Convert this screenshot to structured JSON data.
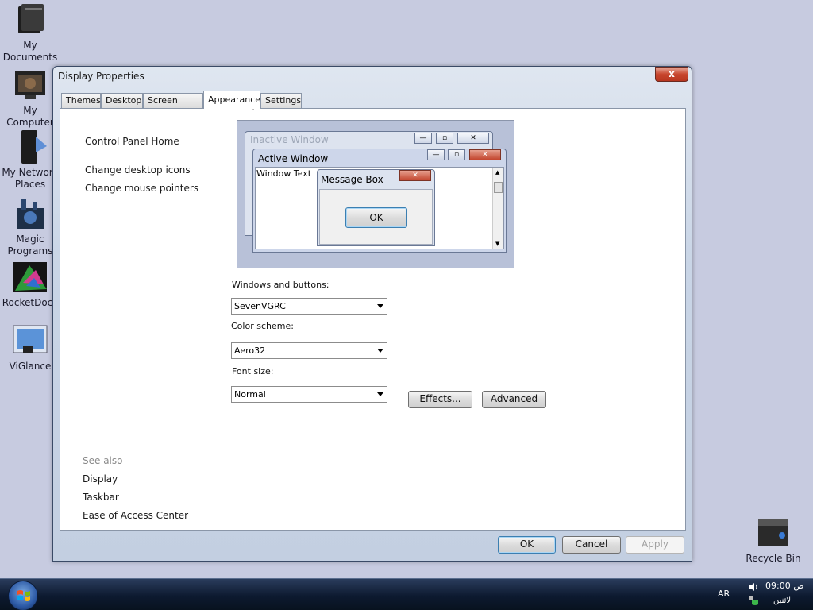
{
  "desktop": {
    "icons": [
      {
        "label": "My Documents",
        "icon": "documents-icon"
      },
      {
        "label": "My Computer",
        "icon": "computer-icon"
      },
      {
        "label": "My Network Places",
        "icon": "network-icon"
      },
      {
        "label": "Magic Programs",
        "icon": "magic-programs-icon"
      },
      {
        "label": "RocketDock",
        "icon": "rocketdock-icon"
      },
      {
        "label": "ViGlance",
        "icon": "viglance-icon"
      },
      {
        "label": "Recycle Bin",
        "icon": "recycle-bin-icon"
      }
    ]
  },
  "window": {
    "title": "Display Properties",
    "close": "x",
    "tabs": [
      "Themes",
      "Desktop",
      "Screen Saver",
      "Appearance",
      "Settings"
    ],
    "active_tab": "Appearance"
  },
  "sidebar": {
    "home": "Control Panel Home",
    "tasks": [
      "Change desktop icons",
      "Change mouse pointers"
    ],
    "see_also_label": "See also",
    "see_also": [
      "Display",
      "Taskbar",
      "Ease of Access Center"
    ]
  },
  "preview": {
    "inactive_title": "Inactive Window",
    "active_title": "Active Window",
    "window_text": "Window Text",
    "message_title": "Message Box",
    "ok": "OK"
  },
  "form": {
    "windows_buttons_label": "Windows and buttons:",
    "windows_buttons_value": "SevenVGRC",
    "color_scheme_label": "Color scheme:",
    "color_scheme_value": "Aero32",
    "font_size_label": "Font size:",
    "font_size_value": "Normal",
    "effects": "Effects...",
    "advanced": "Advanced"
  },
  "dialog_buttons": {
    "ok": "OK",
    "cancel": "Cancel",
    "apply": "Apply"
  },
  "taskbar": {
    "language": "AR",
    "time": "09:00 ص",
    "day": "الاثنين"
  }
}
